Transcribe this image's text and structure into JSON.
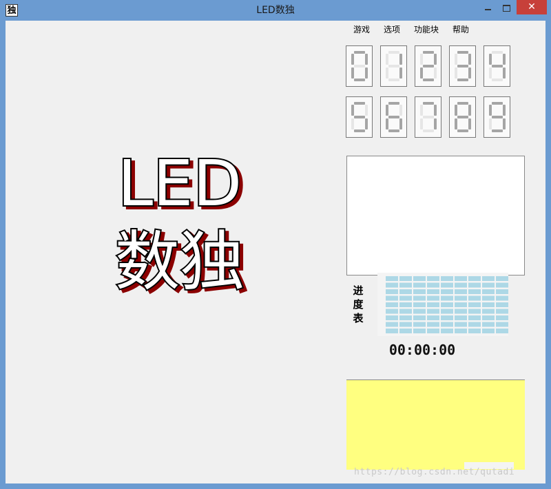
{
  "window": {
    "icon_char": "独",
    "title": "LED数独",
    "close_symbol": "✕"
  },
  "menu": [
    "游戏",
    "选项",
    "功能块",
    "帮助"
  ],
  "logo": {
    "line1": "LED",
    "line2": "数独"
  },
  "led_row_1": [
    "0",
    "1",
    "2",
    "3",
    "4"
  ],
  "led_row_2": [
    "5",
    "6",
    "7",
    "8",
    "9"
  ],
  "progress": {
    "label": "进度表"
  },
  "timer": "00:00:00",
  "watermark": "https://blog.csdn.net/qutadi",
  "colors": {
    "titlebar": "#6b9bd1",
    "close": "#c7403a",
    "yellow": "#ffff80",
    "progress_cells": "#add8e6"
  }
}
